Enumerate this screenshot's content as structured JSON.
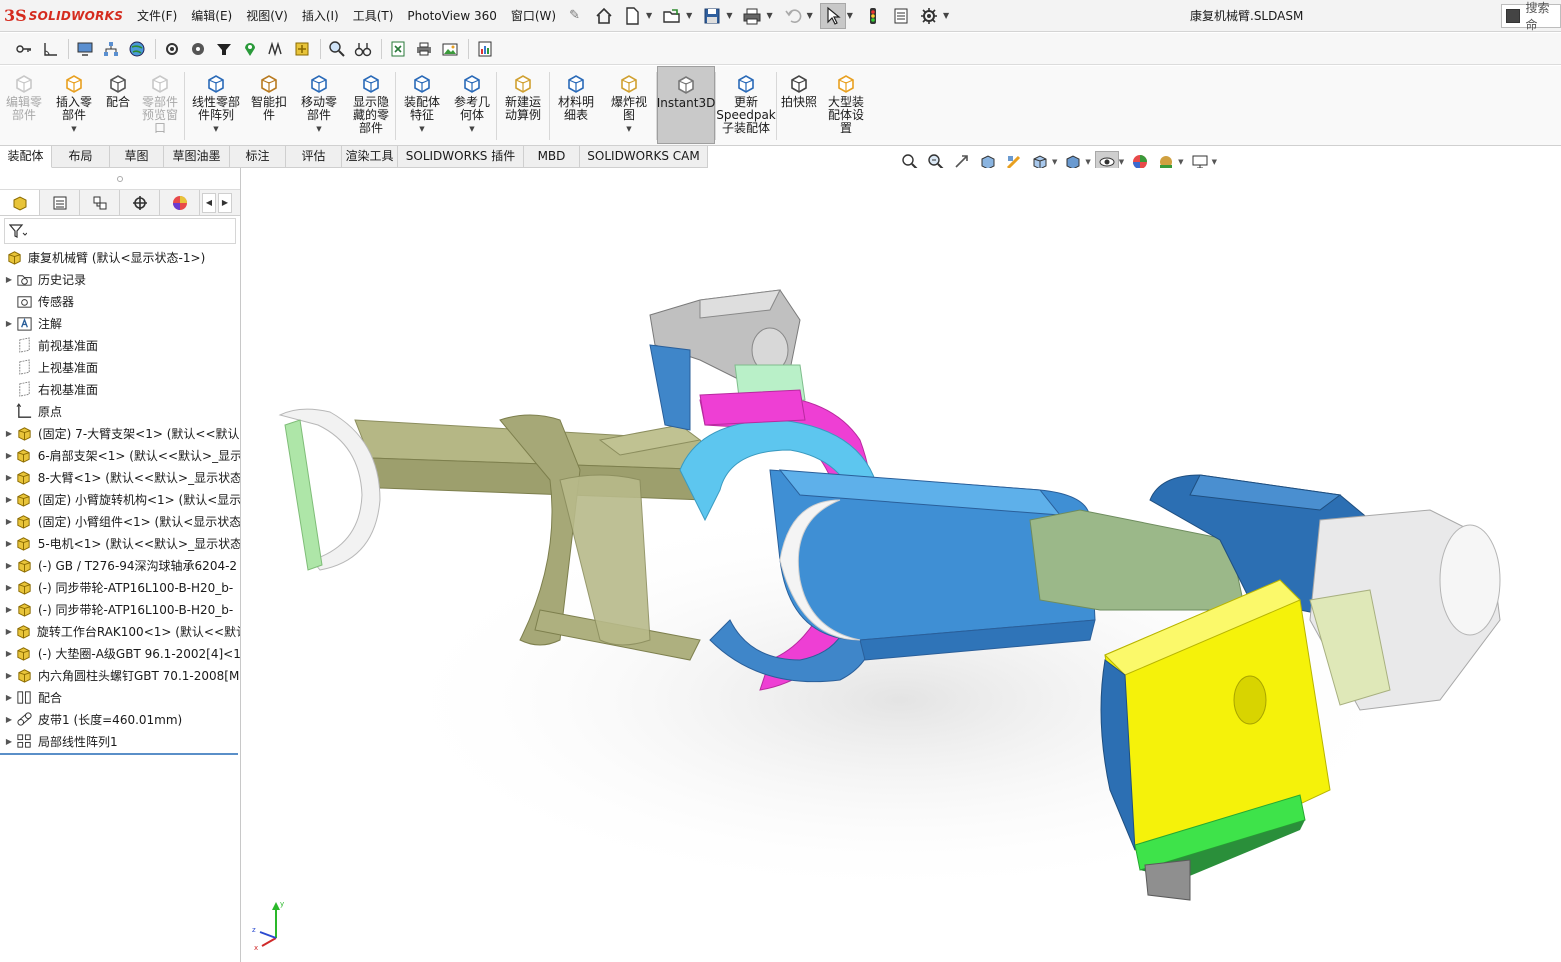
{
  "app": {
    "logo_mark": "3S",
    "logo_text": "SOLIDWORKS",
    "document_title": "康复机械臂.SLDASM",
    "search_placeholder": "搜索命"
  },
  "menu": {
    "items": [
      "文件(F)",
      "编辑(E)",
      "视图(V)",
      "插入(I)",
      "工具(T)",
      "PhotoView 360",
      "窗口(W)"
    ]
  },
  "command_manager": {
    "commands": [
      {
        "label": "编辑零\n部件",
        "disabled": true,
        "arrow": false
      },
      {
        "label": "插入零\n部件",
        "disabled": false,
        "arrow": true
      },
      {
        "label": "配合",
        "disabled": false,
        "arrow": false
      },
      {
        "label": "零部件\n预览窗\n口",
        "disabled": true,
        "arrow": false
      },
      {
        "label": "线性零部\n件阵列",
        "disabled": false,
        "arrow": true
      },
      {
        "label": "智能扣\n件",
        "disabled": false,
        "arrow": false
      },
      {
        "label": "移动零\n部件",
        "disabled": false,
        "arrow": true
      },
      {
        "label": "显示隐\n藏的零\n部件",
        "disabled": false,
        "arrow": false
      },
      {
        "label": "装配体\n特征",
        "disabled": false,
        "arrow": true
      },
      {
        "label": "参考几\n何体",
        "disabled": false,
        "arrow": true
      },
      {
        "label": "新建运\n动算例",
        "disabled": false,
        "arrow": false
      },
      {
        "label": "材料明\n细表",
        "disabled": false,
        "arrow": false
      },
      {
        "label": "爆炸视\n图",
        "disabled": false,
        "arrow": true
      },
      {
        "label": "Instant3D",
        "disabled": false,
        "arrow": false,
        "active": true
      },
      {
        "label": "更新\nSpeedpak\n子装配体",
        "disabled": false,
        "arrow": false
      },
      {
        "label": "拍快照",
        "disabled": false,
        "arrow": false
      },
      {
        "label": "大型装\n配体设\n置",
        "disabled": false,
        "arrow": false
      }
    ]
  },
  "tabs": [
    {
      "label": "装配体",
      "active": true
    },
    {
      "label": "布局"
    },
    {
      "label": "草图"
    },
    {
      "label": "草图油墨"
    },
    {
      "label": "标注"
    },
    {
      "label": "评估"
    },
    {
      "label": "渲染工具"
    },
    {
      "label": "SOLIDWORKS 插件"
    },
    {
      "label": "MBD"
    },
    {
      "label": "SOLIDWORKS CAM"
    }
  ],
  "feature_tree": {
    "root": "康复机械臂 (默认<显示状态-1>)",
    "items": [
      {
        "label": "历史记录",
        "icon": "history-folder-icon",
        "expandable": true
      },
      {
        "label": "传感器",
        "icon": "sensor-icon",
        "expandable": false
      },
      {
        "label": "注解",
        "icon": "annotation-icon",
        "expandable": true
      },
      {
        "label": "前视基准面",
        "icon": "plane-icon",
        "expandable": false
      },
      {
        "label": "上视基准面",
        "icon": "plane-icon",
        "expandable": false
      },
      {
        "label": "右视基准面",
        "icon": "plane-icon",
        "expandable": false
      },
      {
        "label": "原点",
        "icon": "origin-icon",
        "expandable": false
      },
      {
        "label": "(固定) 7-大臂支架<1> (默认<<默认",
        "icon": "subassembly-icon",
        "expandable": true
      },
      {
        "label": "6-肩部支架<1> (默认<<默认>_显示",
        "icon": "subassembly-icon",
        "expandable": true
      },
      {
        "label": "8-大臂<1> (默认<<默认>_显示状态",
        "icon": "subassembly-icon",
        "expandable": true
      },
      {
        "label": "(固定) 小臂旋转机构<1> (默认<显示",
        "icon": "subassembly-icon",
        "expandable": true
      },
      {
        "label": "(固定) 小臂组件<1> (默认<显示状态",
        "icon": "subassembly-icon",
        "expandable": true
      },
      {
        "label": "5-电机<1> (默认<<默认>_显示状态",
        "icon": "subassembly-icon",
        "expandable": true
      },
      {
        "label": "(-) GB / T276-94深沟球轴承6204-2",
        "icon": "subassembly-icon",
        "expandable": true
      },
      {
        "label": "(-) 同步带轮-ATP16L100-B-H20_b-",
        "icon": "subassembly-icon",
        "expandable": true
      },
      {
        "label": "(-) 同步带轮-ATP16L100-B-H20_b-",
        "icon": "subassembly-icon",
        "expandable": true
      },
      {
        "label": "旋转工作台RAK100<1> (默认<<默认",
        "icon": "subassembly-icon",
        "expandable": true
      },
      {
        "label": "(-) 大垫圈-A级GBT 96.1-2002[4]<1",
        "icon": "subassembly-icon",
        "expandable": true
      },
      {
        "label": "内六角圆柱头螺钉GBT 70.1-2008[M",
        "icon": "subassembly-icon",
        "expandable": true
      },
      {
        "label": "配合",
        "icon": "mates-icon",
        "expandable": true
      },
      {
        "label": "皮带1 (长度=460.01mm)",
        "icon": "belt-icon",
        "expandable": true
      },
      {
        "label": "局部线性阵列1",
        "icon": "pattern-icon",
        "expandable": true
      }
    ]
  },
  "triad": {
    "x": "x",
    "y": "y",
    "z": "z"
  },
  "colors": {
    "olive": "#a8ab7c",
    "blue": "#3f86c9",
    "cyan": "#5dc6ef",
    "magenta": "#ee3fd4",
    "yellow": "#f5f20a",
    "green": "#3ee34a",
    "sage": "#9bb889",
    "white_part": "#e9e9ea"
  }
}
